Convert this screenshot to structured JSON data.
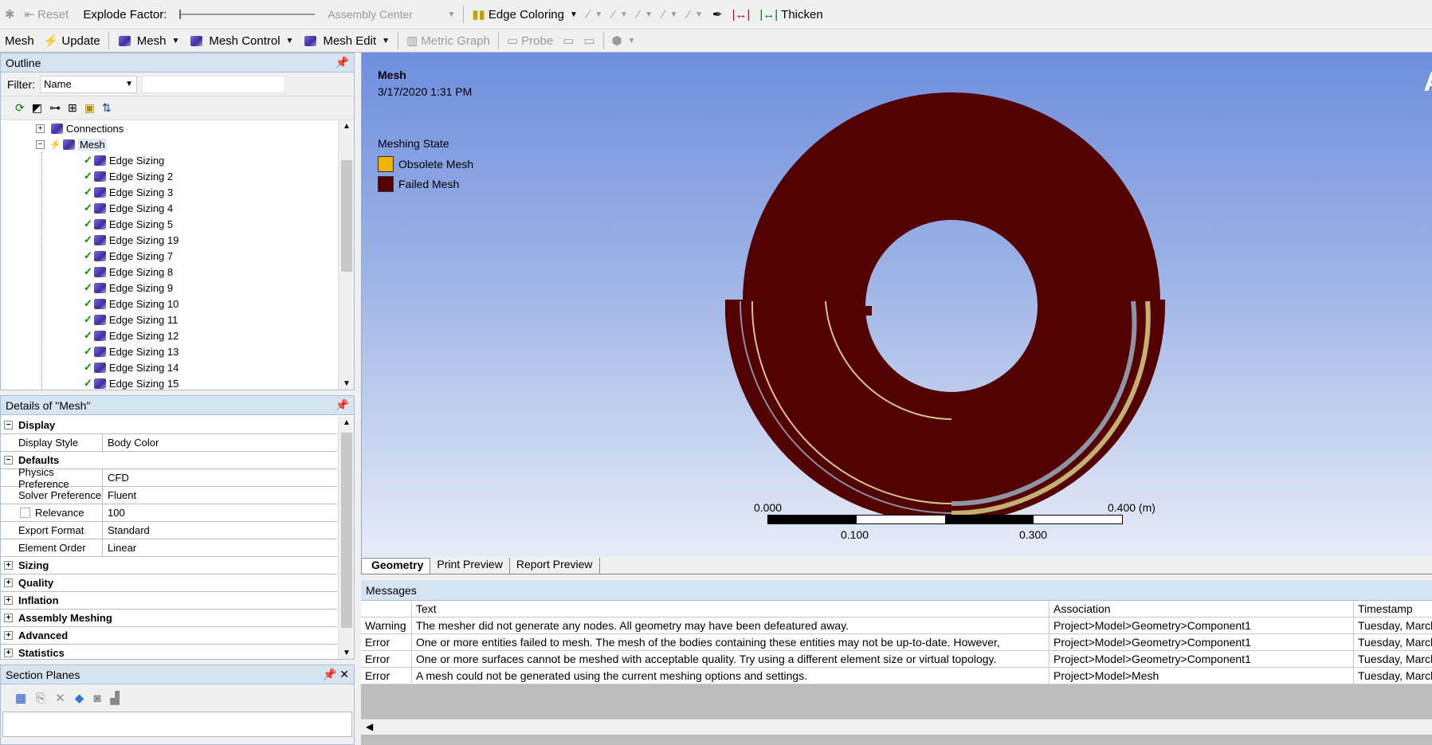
{
  "toolbar1": {
    "reset": "Reset",
    "explode_label": "Explode Factor:",
    "assembly_center": "Assembly Center",
    "edge_coloring": "Edge Coloring",
    "thicken": "Thicken"
  },
  "toolbar2": {
    "mesh": "Mesh",
    "update": "Update",
    "mesh_dd": "Mesh",
    "mesh_control": "Mesh Control",
    "mesh_edit": "Mesh Edit",
    "metric_graph": "Metric Graph",
    "probe": "Probe"
  },
  "outline": {
    "title": "Outline",
    "filter_label": "Filter:",
    "filter_value": "Name",
    "tree": [
      {
        "label": "Connections"
      },
      {
        "label": "Mesh"
      },
      {
        "label": "Edge Sizing"
      },
      {
        "label": "Edge Sizing 2"
      },
      {
        "label": "Edge Sizing 3"
      },
      {
        "label": "Edge Sizing 4"
      },
      {
        "label": "Edge Sizing 5"
      },
      {
        "label": "Edge Sizing 19"
      },
      {
        "label": "Edge Sizing 7"
      },
      {
        "label": "Edge Sizing 8"
      },
      {
        "label": "Edge Sizing 9"
      },
      {
        "label": "Edge Sizing 10"
      },
      {
        "label": "Edge Sizing 11"
      },
      {
        "label": "Edge Sizing 12"
      },
      {
        "label": "Edge Sizing 13"
      },
      {
        "label": "Edge Sizing 14"
      },
      {
        "label": "Edge Sizing 15"
      }
    ]
  },
  "details": {
    "title": "Details of \"Mesh\"",
    "rows": [
      {
        "key": "Display",
        "value": "",
        "group": true,
        "expanded": true
      },
      {
        "key": "Display Style",
        "value": "Body Color"
      },
      {
        "key": "Defaults",
        "value": "",
        "group": true,
        "expanded": true
      },
      {
        "key": "Physics Preference",
        "value": "CFD"
      },
      {
        "key": "Solver Preference",
        "value": "Fluent"
      },
      {
        "key": "Relevance",
        "value": "100"
      },
      {
        "key": "Export Format",
        "value": "Standard"
      },
      {
        "key": "Element Order",
        "value": "Linear"
      },
      {
        "key": "Sizing",
        "value": "",
        "group": true,
        "expanded": false
      },
      {
        "key": "Quality",
        "value": "",
        "group": true,
        "expanded": false
      },
      {
        "key": "Inflation",
        "value": "",
        "group": true,
        "expanded": false
      },
      {
        "key": "Assembly Meshing",
        "value": "",
        "group": true,
        "expanded": false
      },
      {
        "key": "Advanced",
        "value": "",
        "group": true,
        "expanded": false
      },
      {
        "key": "Statistics",
        "value": "",
        "group": true,
        "expanded": false
      }
    ]
  },
  "section_planes": {
    "title": "Section Planes"
  },
  "viewport": {
    "title": "Mesh",
    "date": "3/17/2020 1:31 PM",
    "legend_title": "Meshing State",
    "legend": [
      {
        "label": "Obsolete Mesh",
        "color": "#f2b400"
      },
      {
        "label": "Failed Mesh",
        "color": "#550000"
      }
    ],
    "scale_left": "0.000",
    "scale_right": "0.400 (m)",
    "scale_mid1": "0.100",
    "scale_mid2": "0.300",
    "corner": "A",
    "mesh_color": "#520000"
  },
  "tabs": [
    "Geometry",
    "Print Preview",
    "Report Preview"
  ],
  "messages": {
    "title": "Messages",
    "headers": [
      "Text",
      "Association",
      "Timestamp"
    ],
    "rows": [
      {
        "type": "Warning",
        "text": "The mesher did not generate any nodes.  All geometry may have been defeatured away.",
        "assoc": "Project>Model>Geometry>Component1",
        "time": "Tuesday, March"
      },
      {
        "type": "Error",
        "text": "One or more entities failed to mesh. The mesh of the bodies containing these entities may not be up-to-date.  However,",
        "assoc": "Project>Model>Geometry>Component1",
        "time": "Tuesday, March"
      },
      {
        "type": "Error",
        "text": "One or more surfaces cannot be meshed with acceptable quality. Try using a different element size or virtual topology.",
        "assoc": "Project>Model>Geometry>Component1",
        "time": "Tuesday, March"
      },
      {
        "type": "Error",
        "text": "A mesh could not be generated using the current meshing options and settings.",
        "assoc": "Project>Model>Mesh",
        "time": "Tuesday, March"
      }
    ]
  }
}
